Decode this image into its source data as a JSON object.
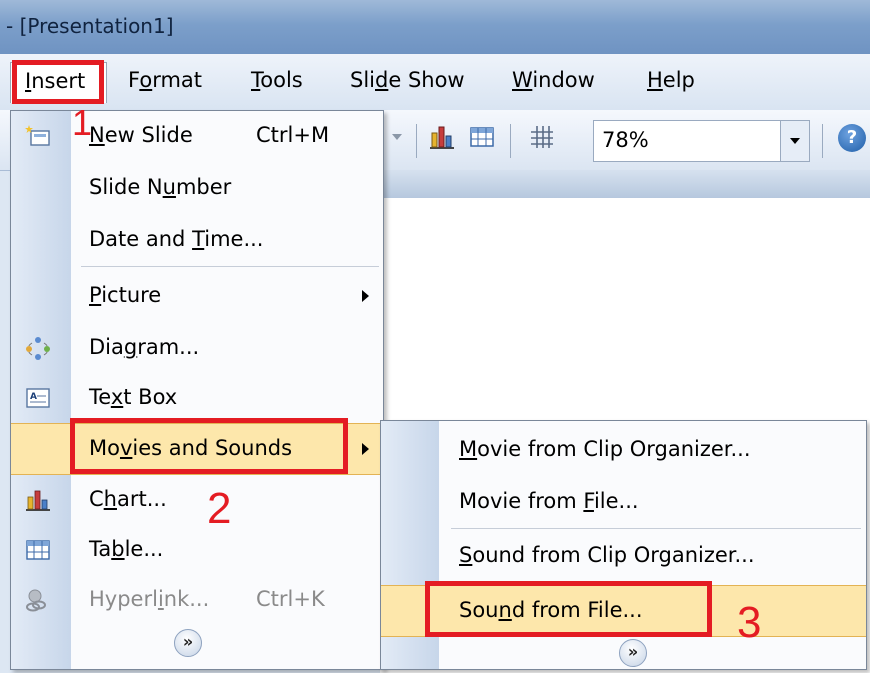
{
  "window": {
    "title": "- [Presentation1]"
  },
  "menubar": {
    "items": [
      {
        "id": "insert",
        "pre": "",
        "acc": "I",
        "post": "nsert"
      },
      {
        "id": "format",
        "pre": "F",
        "acc": "o",
        "post": "rmat"
      },
      {
        "id": "tools",
        "pre": "",
        "acc": "T",
        "post": "ools"
      },
      {
        "id": "slideshow",
        "pre": "Sli",
        "acc": "d",
        "post": "e Show"
      },
      {
        "id": "window",
        "pre": "",
        "acc": "W",
        "post": "indow"
      },
      {
        "id": "help",
        "pre": "",
        "acc": "H",
        "post": "elp"
      }
    ]
  },
  "toolbar": {
    "zoom": "78%",
    "help_icon": "help-icon"
  },
  "insert_menu": {
    "items": [
      {
        "pre": "",
        "acc": "N",
        "post": "ew Slide",
        "shortcut": "Ctrl+M",
        "icon": "new-slide-icon"
      },
      {
        "pre": "Slide N",
        "acc": "u",
        "post": "mber",
        "shortcut": ""
      },
      {
        "pre": "Date and ",
        "acc": "T",
        "post": "ime...",
        "shortcut": ""
      },
      {
        "pre": "",
        "acc": "P",
        "post": "icture",
        "shortcut": "",
        "submenu": true
      },
      {
        "pre": "Dia",
        "acc": "g",
        "post": "ram...",
        "shortcut": "",
        "icon": "diagram-icon"
      },
      {
        "pre": "Te",
        "acc": "x",
        "post": "t Box",
        "shortcut": "",
        "icon": "text-box-icon"
      },
      {
        "pre": "Mo",
        "acc": "v",
        "post": "ies and Sounds",
        "shortcut": "",
        "submenu": true
      },
      {
        "pre": "C",
        "acc": "h",
        "post": "art...",
        "shortcut": "",
        "icon": "chart-icon"
      },
      {
        "pre": "Ta",
        "acc": "b",
        "post": "le...",
        "shortcut": "",
        "icon": "table-icon"
      },
      {
        "pre": "Hyperl",
        "acc": "i",
        "post": "nk...",
        "shortcut": "Ctrl+K",
        "icon": "hyperlink-icon",
        "disabled": true
      }
    ]
  },
  "movies_submenu": {
    "items": [
      {
        "pre": "",
        "acc": "M",
        "post": "ovie from Clip Organizer..."
      },
      {
        "pre": "Movie from ",
        "acc": "F",
        "post": "ile..."
      },
      {
        "pre": "",
        "acc": "S",
        "post": "ound from Clip Organizer..."
      },
      {
        "pre": "Sou",
        "acc": "n",
        "post": "d from File..."
      }
    ]
  },
  "annotations": {
    "step1": "1",
    "step2": "2",
    "step3": "3"
  },
  "colors": {
    "annotation": "#e41c23",
    "highlight": "#fde7ab",
    "menubar": "#dde7f3"
  }
}
